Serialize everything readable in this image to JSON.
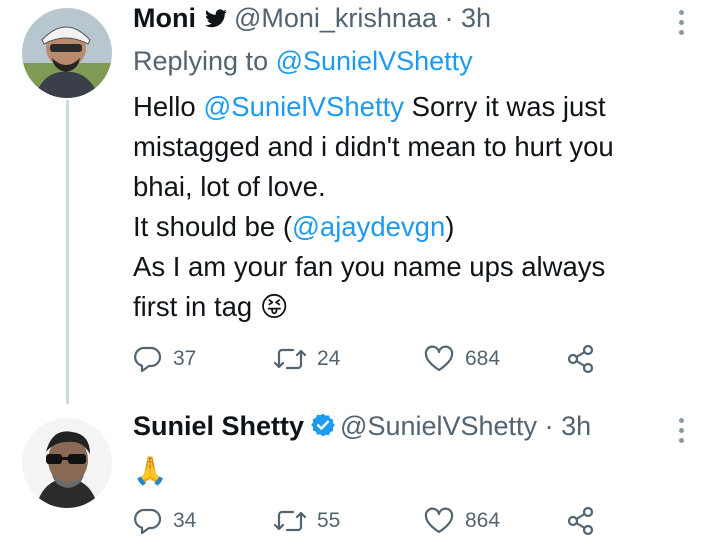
{
  "tweets": [
    {
      "name": "Moni",
      "handle": "@Moni_krishnaa",
      "separator": "·",
      "time": "3h",
      "replying_prefix": "Replying to",
      "replying_to": "@SunielVShetty",
      "body": {
        "l1_pre": "Hello ",
        "l1_mention": "@SunielVShetty",
        "l1_post": " Sorry it was just",
        "l2": "mistagged and i didn't mean to hurt you",
        "l3": "bhai, lot of love.",
        "l4_pre": "It should be (",
        "l4_mention": "@ajaydevgn",
        "l4_post": ")",
        "l5": "As I am your fan you name ups always",
        "l6": "first in tag",
        "emoji": "😝"
      },
      "stats": {
        "replies": "37",
        "retweets": "24",
        "likes": "684"
      }
    },
    {
      "name": "Suniel Shetty",
      "handle": "@SunielVShetty",
      "separator": "·",
      "time": "3h",
      "body": {
        "emoji": "🙏"
      },
      "stats": {
        "replies": "34",
        "retweets": "55",
        "likes": "864"
      }
    }
  ],
  "icons": {
    "reply": "reply-icon",
    "retweet": "retweet-icon",
    "like": "heart-icon",
    "share": "share-icon",
    "more": "more-options-icon",
    "verified": "verified-badge-icon",
    "twitter_bird": "twitter-bird-icon"
  },
  "colors": {
    "link": "#1d9bf0",
    "secondary": "#536471",
    "verified": "#1d9bf0",
    "thread_line": "#cfd9de"
  }
}
